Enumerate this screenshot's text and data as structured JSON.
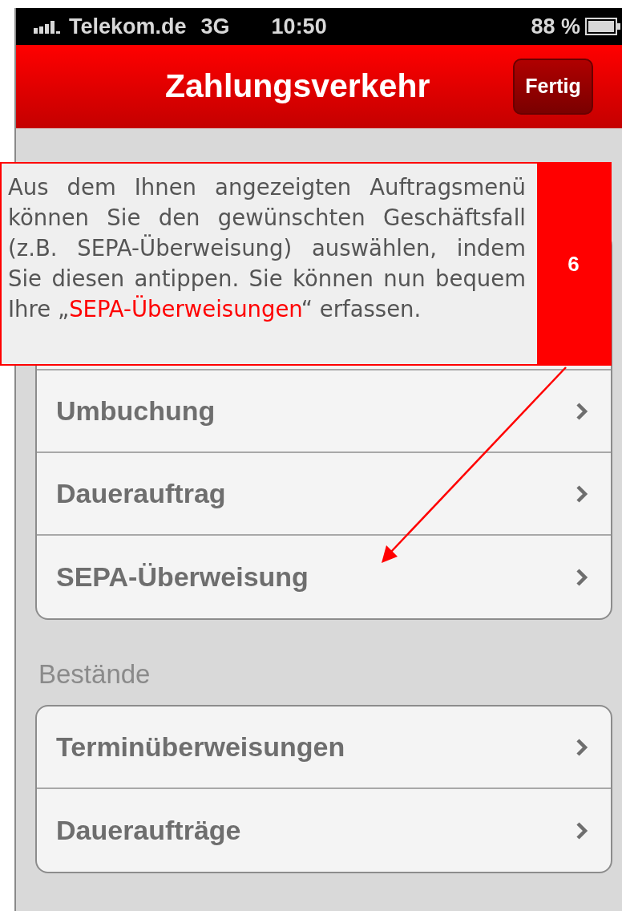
{
  "status_bar": {
    "carrier": "Telekom.de",
    "network": "3G",
    "time": "10:50",
    "battery": "88 %"
  },
  "nav_bar": {
    "title": "Zahlungsverkehr",
    "button": "Fertig"
  },
  "sections": [
    {
      "items": [
        "Umbuchung",
        "Dauerauftrag",
        "SEPA-Überweisung"
      ]
    },
    {
      "header": "Bestände",
      "items": [
        "Terminüberweisungen",
        "Daueraufträge"
      ]
    }
  ],
  "callout": {
    "number": "6",
    "parts": [
      {
        "text": "Aus dem Ihnen angezeigten Auftragsmenü können Sie den gewünschten Geschäftsfall (z.B. SEPA-Überweisung) auswählen, indem Sie diesen antippen. Sie können nun bequem Ihre „",
        "highlight": false
      },
      {
        "text": "SEPA-Überweisungen",
        "highlight": true
      },
      {
        "text": "“ erfassen.",
        "highlight": false
      }
    ]
  }
}
